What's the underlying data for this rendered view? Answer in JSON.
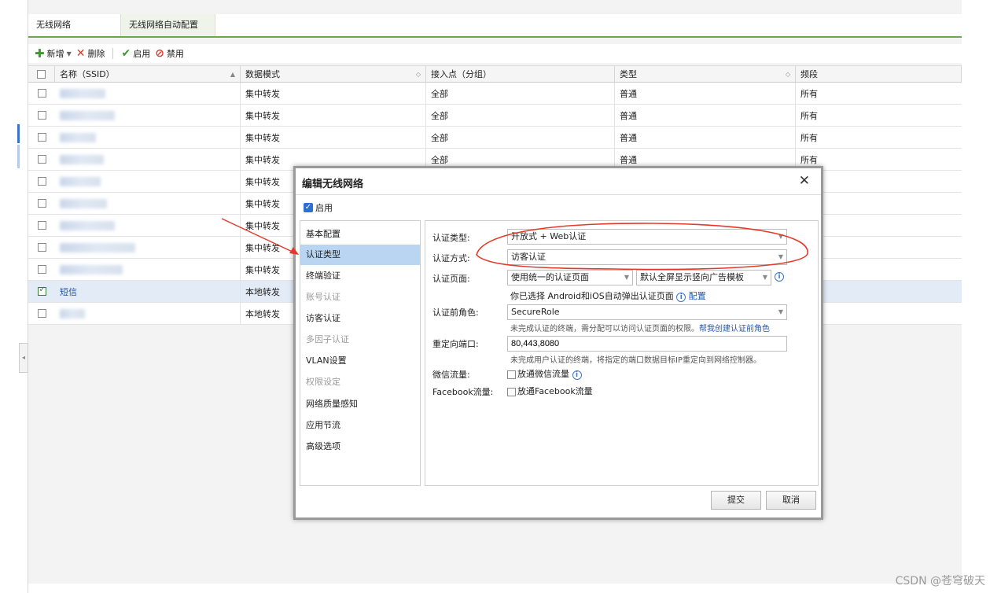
{
  "tabs": [
    "无线网络",
    "无线网络自动配置"
  ],
  "toolbar": {
    "add": "新增",
    "delete": "删除",
    "enable": "启用",
    "disable": "禁用"
  },
  "columns": {
    "name": "名称（SSID）",
    "mode": "数据模式",
    "ap": "接入点（分组）",
    "type": "类型",
    "band": "频段"
  },
  "rows": [
    {
      "name": "",
      "mode": "集中转发",
      "ap": "全部",
      "type": "普通",
      "band": "所有",
      "checked": false
    },
    {
      "name": "",
      "mode": "集中转发",
      "ap": "全部",
      "type": "普通",
      "band": "所有",
      "checked": false
    },
    {
      "name": "",
      "mode": "集中转发",
      "ap": "全部",
      "type": "普通",
      "band": "所有",
      "checked": false
    },
    {
      "name": "",
      "mode": "集中转发",
      "ap": "全部",
      "type": "普通",
      "band": "所有",
      "checked": false
    },
    {
      "name": "",
      "mode": "集中转发",
      "ap": "",
      "type": "",
      "band": "",
      "checked": false
    },
    {
      "name": "",
      "mode": "集中转发",
      "ap": "",
      "type": "",
      "band": "",
      "checked": false
    },
    {
      "name": "",
      "mode": "集中转发",
      "ap": "",
      "type": "",
      "band": "",
      "checked": false
    },
    {
      "name": "",
      "mode": "集中转发",
      "ap": "",
      "type": "",
      "band": "",
      "checked": false
    },
    {
      "name": "",
      "mode": "集中转发",
      "ap": "",
      "type": "",
      "band": "",
      "checked": false
    },
    {
      "name": "短信",
      "mode": "本地转发",
      "ap": "",
      "type": "",
      "band": "",
      "checked": true
    },
    {
      "name": "",
      "mode": "本地转发",
      "ap": "",
      "type": "",
      "band": "",
      "checked": false
    }
  ],
  "dialog": {
    "title": "编辑无线网络",
    "enable_label": "启用",
    "nav": [
      {
        "label": "基本配置",
        "disabled": false,
        "active": false
      },
      {
        "label": "认证类型",
        "disabled": false,
        "active": true
      },
      {
        "label": "终端验证",
        "disabled": false,
        "active": false
      },
      {
        "label": "账号认证",
        "disabled": true,
        "active": false
      },
      {
        "label": "访客认证",
        "disabled": false,
        "active": false
      },
      {
        "label": "多因子认证",
        "disabled": true,
        "active": false
      },
      {
        "label": "VLAN设置",
        "disabled": false,
        "active": false
      },
      {
        "label": "权限设定",
        "disabled": true,
        "active": false
      },
      {
        "label": "网络质量感知",
        "disabled": false,
        "active": false
      },
      {
        "label": "应用节流",
        "disabled": false,
        "active": false
      },
      {
        "label": "高级选项",
        "disabled": false,
        "active": false
      }
    ],
    "auth_type_label": "认证类型:",
    "auth_type_value": "开放式 + Web认证",
    "auth_method_label": "认证方式:",
    "auth_method_value": "访客认证",
    "auth_page_label": "认证页面:",
    "auth_page_value": "使用统一的认证页面",
    "template_value": "默认全屏显示竖向广告模板",
    "android_hint": "你已选择 Android和iOS自动弹出认证页面",
    "config_link": "配置",
    "pre_role_label": "认证前角色:",
    "pre_role_value": "SecureRole",
    "pre_role_hint": "未完成认证的终端，需分配可以访问认证页面的权限。",
    "pre_role_link": "帮我创建认证前角色",
    "redirect_label": "重定向端口:",
    "redirect_value": "80,443,8080",
    "redirect_hint": "未完成用户认证的终端，将指定的端口数据目标IP重定向到网络控制器。",
    "wechat_label": "微信流量:",
    "wechat_option": "放通微信流量",
    "facebook_label": "Facebook流量:",
    "facebook_option": "放通Facebook流量",
    "submit": "提交",
    "cancel": "取消"
  },
  "watermark": "CSDN @苍穹破天",
  "colors": {
    "accent_green": "#6aa84f",
    "selection": "#b9d5f2",
    "link": "#1f56b8",
    "annotation_red": "#e23a2a"
  }
}
